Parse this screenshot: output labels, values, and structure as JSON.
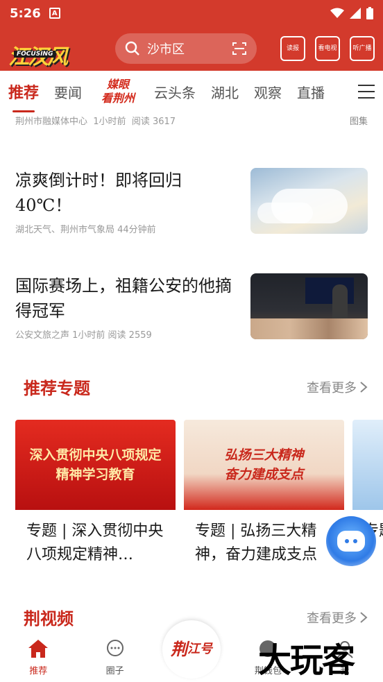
{
  "status_bar": {
    "time": "5:26",
    "a_badge": "A"
  },
  "header": {
    "logo_text": "江汉风",
    "logo_sub": "FOCUSING",
    "search_text": "沙市区",
    "icon_read": "读报",
    "icon_tv": "看电视",
    "icon_radio": "听广播"
  },
  "tabs": {
    "items": [
      "推荐",
      "要闻"
    ],
    "special": [
      "媒眼",
      "看荆州"
    ],
    "items2": [
      "云头条",
      "湖北",
      "观察",
      "直播"
    ]
  },
  "feed": {
    "top_meta": {
      "source": "荆州市融媒体中心",
      "time": "1小时前",
      "reads": "阅读 3617",
      "tag": "图集"
    },
    "articles": [
      {
        "title": "凉爽倒计时！即将回归40℃！",
        "meta": "湖北天气、荆州市气象局  44分钟前"
      },
      {
        "title": "国际赛场上，祖籍公安的他摘得冠军",
        "meta": "公安文旅之声  1小时前  阅读 2559"
      }
    ]
  },
  "topics": {
    "title": "推荐专题",
    "more": "查看更多",
    "cards": [
      {
        "banner": [
          "深入贯彻中央八项规定",
          "精神学习教育"
        ],
        "title": "专题 | 深入贯彻中央八项规定精神…"
      },
      {
        "banner": [
          "弘扬三大精神",
          "奋力建成支点"
        ],
        "title": "专题 | 弘扬三大精神，奋力建成支点"
      },
      {
        "banner": [
          "",
          ""
        ],
        "title": "专题 | 名媛"
      }
    ]
  },
  "video": {
    "title": "荆视频",
    "more": "查看更多"
  },
  "bottom_nav": {
    "items": [
      "推荐",
      "圈子",
      "荆钱包",
      "我"
    ],
    "center": [
      "荆",
      "江号"
    ]
  },
  "watermark": "大玩客",
  "colors": {
    "brand_red": "#d33a2c",
    "accent": "#c9281c"
  }
}
